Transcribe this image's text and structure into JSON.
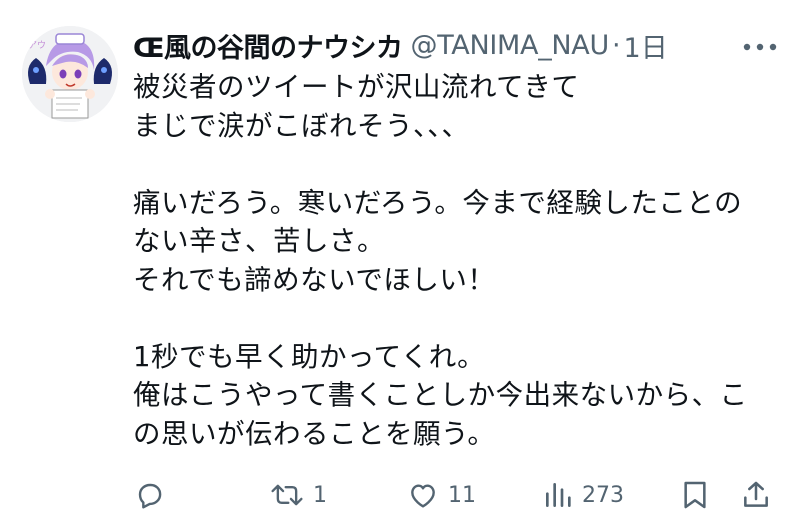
{
  "author": {
    "badge": "Œ",
    "display_name": "風の谷間のナウシカ",
    "handle": "@TANIMA_NAU",
    "separator": "·",
    "timestamp": "1日",
    "avatar_text": "アウ"
  },
  "tweet": {
    "lines": [
      "被災者のツイートが沢山流れてきて",
      "まじで涙がこぼれそう、、、",
      "",
      "痛いだろう。寒いだろう。今まで経験したことの",
      "ない辛さ、苦しさ。",
      "それでも諦めないでほしい！",
      "",
      "1秒でも早く助かってくれ。",
      "俺はこうやって書くことしか今出来ないから、こ",
      "の思いが伝わることを願う。"
    ]
  },
  "actions": {
    "reply_icon": "reply-icon",
    "retweet_icon": "retweet-icon",
    "retweet_count": "1",
    "like_icon": "like-icon",
    "like_count": "11",
    "views_icon": "views-icon",
    "views_count": "273",
    "bookmark_icon": "bookmark-icon",
    "share_icon": "share-icon"
  },
  "colors": {
    "text": "#0f1419",
    "secondary": "#536471"
  }
}
